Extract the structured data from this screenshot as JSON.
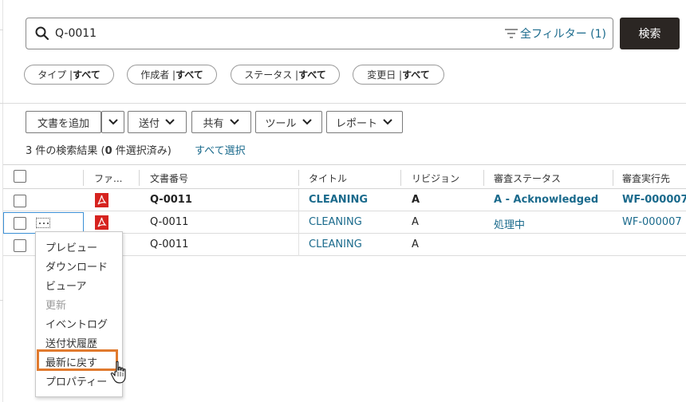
{
  "search": {
    "query": "Q-0011",
    "filter_label": "全フィルター (1)",
    "button_label": "検索"
  },
  "chips": [
    {
      "prefix": "タイプ | ",
      "value": "すべて"
    },
    {
      "prefix": "作成者 | ",
      "value": "すべて"
    },
    {
      "prefix": "ステータス | ",
      "value": "すべて"
    },
    {
      "prefix": "変更日 | ",
      "value": "すべて"
    }
  ],
  "toolbar": {
    "add_document": "文書を追加",
    "send": "送付",
    "share": "共有",
    "tools": "ツール",
    "report": "レポート"
  },
  "results": {
    "prefix": "3 件の検索結果 (",
    "selected_count": "0",
    "suffix": " 件選択済み)",
    "select_all": "すべて選択"
  },
  "table": {
    "headers": {
      "file": "ファ...",
      "doc_number": "文書番号",
      "title": "タイトル",
      "revision": "リビジョン",
      "review_status": "審査ステータス",
      "review_exec": "審査実行先"
    },
    "rows": [
      {
        "doc_number": "Q-0011",
        "title": "CLEANING",
        "revision": "A",
        "review_status": "A - Acknowledged",
        "review_exec": "WF-000007"
      },
      {
        "doc_number": "Q-0011",
        "title": "CLEANING",
        "revision": "A",
        "review_status": "処理中",
        "review_exec": "WF-000007"
      },
      {
        "doc_number": "Q-0011",
        "title": "CLEANING",
        "revision": "A",
        "review_status": "",
        "review_exec": ""
      }
    ]
  },
  "context_menu": {
    "items": [
      "プレビュー",
      "ダウンロード",
      "ビューア",
      "更新",
      "イベントログ",
      "送付状履歴",
      "最新に戻す",
      "プロパティー"
    ],
    "disabled": [
      "更新"
    ],
    "highlighted": "最新に戻す"
  },
  "colors": {
    "link": "#1a6a8c",
    "primary_button": "#2b2623",
    "highlight_border": "#e07a2e",
    "pdf_red": "#d6231f"
  },
  "icons": {
    "search": "search-icon",
    "filter": "filter-icon",
    "dropdown": "chevron-down-icon",
    "file_type": "pdf-icon",
    "more": "more-options-icon",
    "cursor": "hand-pointer-icon"
  }
}
